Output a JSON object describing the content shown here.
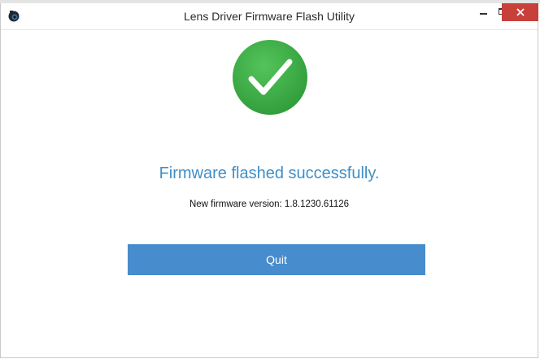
{
  "window": {
    "title": "Lens Driver Firmware Flash Utility",
    "controls": {
      "minimize": "minimize-icon",
      "maximize": "maximize-icon",
      "close": "close-icon"
    }
  },
  "main": {
    "status_icon": "checkmark-circle-icon",
    "headline": "Firmware flashed successfully.",
    "version_text": "New firmware version: 1.8.1230.61126",
    "quit_label": "Quit"
  },
  "colors": {
    "accent_text": "#3f8fc8",
    "button": "#478ccc",
    "success_green": "#3fae48",
    "close_red": "#c7403a"
  }
}
